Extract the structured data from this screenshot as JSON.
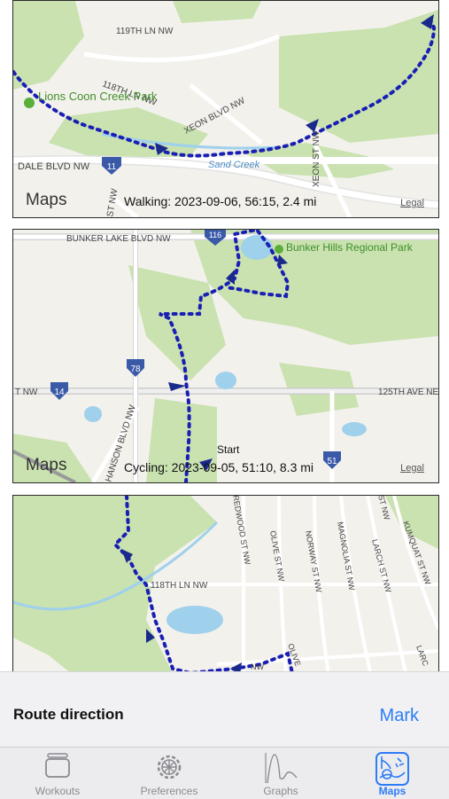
{
  "maps": [
    {
      "caption": "Walking: 2023-09-06, 56:15,  2.4 mi",
      "labels": {
        "street1": "119TH LN NW",
        "street2": "118TH LN NW",
        "street3": "XEON BLVD NW",
        "street4": "DALE BLVD NW",
        "street5": "XEON ST NW",
        "street6": "ST NW",
        "park": "Lions Coon Creek Park",
        "creek": "Sand Creek",
        "shield": "11"
      }
    },
    {
      "caption": "Cycling: 2023-09-05, 51:10,  8.3 mi",
      "start_label": "Start",
      "labels": {
        "street1": "BUNKER LAKE BLVD NW",
        "street2": "125TH AVE NE",
        "street3": "HANSON BLVD NW",
        "street4": "T NW",
        "park": "Bunker Hills Regional Park",
        "shield1": "116",
        "shield2": "78",
        "shield3": "14",
        "shield4": "51"
      }
    },
    {
      "labels": {
        "street1": "118TH LN NW",
        "street2": "REDWOOD ST NW",
        "street3": "OLIVE ST NW",
        "street4": "NORWAY ST NW",
        "street5": "MAGNOLIA ST NW",
        "street6": "LARCH ST NW",
        "street7": "KUMQUAT ST NW",
        "street8": "OLIVE",
        "street9": "NW",
        "street10": "LARC",
        "street11": "ST NW"
      }
    }
  ],
  "map_brand": "Maps",
  "legal": "Legal",
  "sheet": {
    "title": "Route direction",
    "action": "Mark"
  },
  "tabs": [
    {
      "label": "Workouts",
      "icon": "workouts-icon"
    },
    {
      "label": "Preferences",
      "icon": "gear-icon"
    },
    {
      "label": "Graphs",
      "icon": "graph-icon"
    },
    {
      "label": "Maps",
      "icon": "map-icon",
      "active": true
    }
  ],
  "colors": {
    "route": "#1a1fb4",
    "accent": "#2d7cf6",
    "park": "#c9e2b0",
    "water": "#9fd0ec",
    "road": "#ffffff"
  }
}
